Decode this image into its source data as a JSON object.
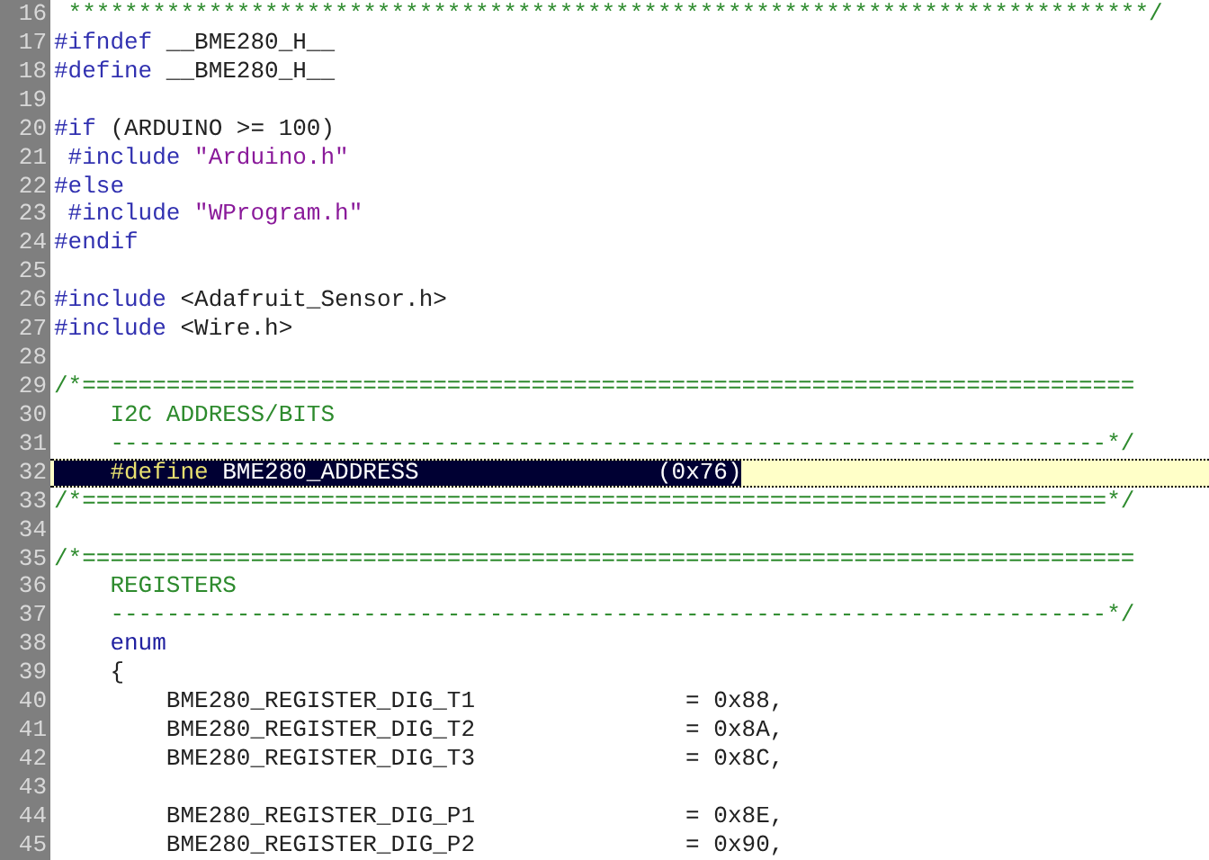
{
  "editor": {
    "lines": [
      {
        "number": "16",
        "selected": false,
        "segments": [
          {
            "kind": "comment",
            "text": " *****************************************************************************/"
          }
        ]
      },
      {
        "number": "17",
        "selected": false,
        "segments": [
          {
            "kind": "directive",
            "text": "#ifndef"
          },
          {
            "kind": "plain",
            "text": " __BME280_H__"
          }
        ]
      },
      {
        "number": "18",
        "selected": false,
        "segments": [
          {
            "kind": "directive",
            "text": "#define"
          },
          {
            "kind": "plain",
            "text": " __BME280_H__"
          }
        ]
      },
      {
        "number": "19",
        "selected": false
      },
      {
        "number": "20",
        "selected": false,
        "segments": [
          {
            "kind": "directive",
            "text": "#if"
          },
          {
            "kind": "plain",
            "text": " (ARDUINO >= 100)"
          }
        ]
      },
      {
        "number": "21",
        "selected": false,
        "segments": [
          {
            "kind": "directive",
            "text": " #include"
          },
          {
            "kind": "string",
            "text": " \"Arduino.h\""
          }
        ]
      },
      {
        "number": "22",
        "selected": false,
        "segments": [
          {
            "kind": "directive",
            "text": "#else"
          }
        ]
      },
      {
        "number": "23",
        "selected": false,
        "segments": [
          {
            "kind": "directive",
            "text": " #include"
          },
          {
            "kind": "string",
            "text": " \"WProgram.h\""
          }
        ]
      },
      {
        "number": "24",
        "selected": false,
        "segments": [
          {
            "kind": "directive",
            "text": "#endif"
          }
        ]
      },
      {
        "number": "25",
        "selected": false
      },
      {
        "number": "26",
        "selected": false,
        "segments": [
          {
            "kind": "directive",
            "text": "#include"
          },
          {
            "kind": "plain",
            "text": " <Adafruit_Sensor.h>"
          }
        ]
      },
      {
        "number": "27",
        "selected": false,
        "segments": [
          {
            "kind": "directive",
            "text": "#include"
          },
          {
            "kind": "plain",
            "text": " <Wire.h>"
          }
        ]
      },
      {
        "number": "28",
        "selected": false
      },
      {
        "number": "29",
        "selected": false,
        "segments": [
          {
            "kind": "comment",
            "text": "/*==========================================================================="
          }
        ]
      },
      {
        "number": "30",
        "selected": false,
        "segments": [
          {
            "kind": "comment",
            "text": "    I2C ADDRESS/BITS"
          }
        ]
      },
      {
        "number": "31",
        "selected": false,
        "segments": [
          {
            "kind": "comment",
            "text": "    -----------------------------------------------------------------------*/"
          }
        ]
      },
      {
        "number": "32",
        "selected": true,
        "segments": [
          {
            "kind": "directive",
            "text": "    #define"
          },
          {
            "kind": "plain",
            "text": " BME280_ADDRESS                 (0x76)"
          }
        ]
      },
      {
        "number": "33",
        "selected": false,
        "segments": [
          {
            "kind": "comment",
            "text": "/*=========================================================================*/"
          }
        ]
      },
      {
        "number": "34",
        "selected": false
      },
      {
        "number": "35",
        "selected": false,
        "segments": [
          {
            "kind": "comment",
            "text": "/*==========================================================================="
          }
        ]
      },
      {
        "number": "36",
        "selected": false,
        "segments": [
          {
            "kind": "comment",
            "text": "    REGISTERS"
          }
        ]
      },
      {
        "number": "37",
        "selected": false,
        "segments": [
          {
            "kind": "comment",
            "text": "    -----------------------------------------------------------------------*/"
          }
        ]
      },
      {
        "number": "38",
        "selected": false,
        "segments": [
          {
            "kind": "keyword",
            "text": "    enum"
          }
        ]
      },
      {
        "number": "39",
        "selected": false,
        "segments": [
          {
            "kind": "plain",
            "text": "    {"
          }
        ]
      },
      {
        "number": "40",
        "selected": false,
        "segments": [
          {
            "kind": "plain",
            "text": "        BME280_REGISTER_DIG_T1               = 0x88,"
          }
        ]
      },
      {
        "number": "41",
        "selected": false,
        "segments": [
          {
            "kind": "plain",
            "text": "        BME280_REGISTER_DIG_T2               = 0x8A,"
          }
        ]
      },
      {
        "number": "42",
        "selected": false,
        "segments": [
          {
            "kind": "plain",
            "text": "        BME280_REGISTER_DIG_T3               = 0x8C,"
          }
        ]
      },
      {
        "number": "43",
        "selected": false
      },
      {
        "number": "44",
        "selected": false,
        "segments": [
          {
            "kind": "plain",
            "text": "        BME280_REGISTER_DIG_P1               = 0x8E,"
          }
        ]
      },
      {
        "number": "45",
        "selected": false,
        "segments": [
          {
            "kind": "plain",
            "text": "        BME280_REGISTER_DIG_P2               = 0x90,"
          }
        ]
      }
    ]
  }
}
